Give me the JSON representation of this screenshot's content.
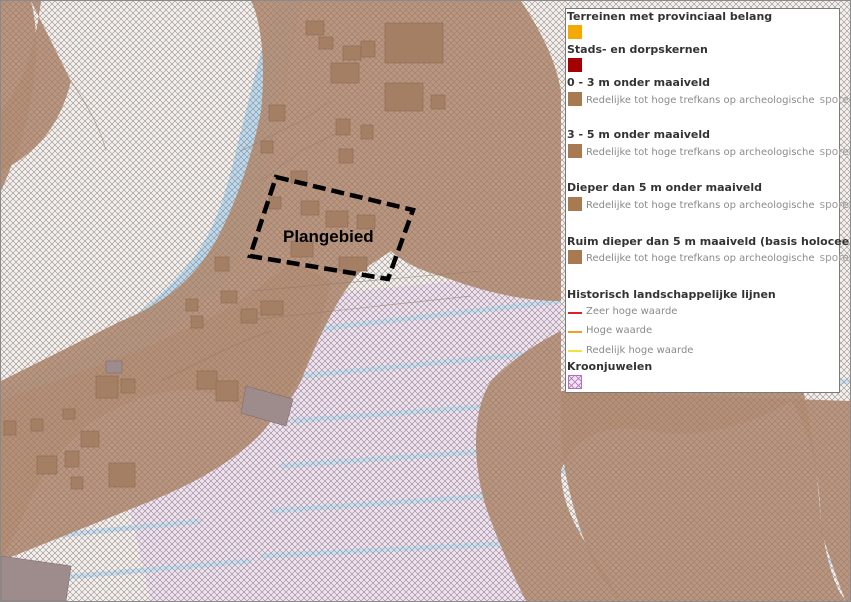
{
  "map": {
    "area_label": "Plangebied",
    "colors": {
      "background": "#f3f1ea",
      "zone_fill": "#b98e6e",
      "water": "#b9dcef",
      "buildings": "#a57f63",
      "kroonjuwelen_hatch": "#8f6f9a"
    }
  },
  "legend": {
    "provinciaal": {
      "title": "Terreinen met provinciaal belang",
      "color": "#f5a800"
    },
    "stads": {
      "title": "Stads- en dorpskernen",
      "color": "#a50000"
    },
    "zone1": {
      "title": "0 - 3 m onder maaiveld",
      "desc": "Redelijke tot hoge trefkans op archeologische",
      "suffix": "sporen",
      "color": "#a87a52"
    },
    "zone2": {
      "title": "3 - 5 m onder maaiveld",
      "desc": "Redelijke tot hoge trefkans op archeologische",
      "suffix": "sporen",
      "color": "#a87a52"
    },
    "zone3": {
      "title": "Dieper dan 5 m onder maaiveld",
      "desc": "Redelijke tot hoge trefkans op archeologische",
      "suffix": "sporen",
      "color": "#a87a52"
    },
    "zone4": {
      "title": "Ruim dieper dan 5 m maaiveld (basis holocee",
      "desc": "Redelijke tot hoge trefkans op archeologische",
      "suffix": "sporen",
      "color": "#a87a52"
    },
    "lijnen": {
      "title": "Historisch landschappelijke lijnen",
      "items": [
        {
          "label": "Zeer hoge waarde",
          "color": "#e02020"
        },
        {
          "label": "Hoge waarde",
          "color": "#f0a020"
        },
        {
          "label": "Redelijk hoge waarde",
          "color": "#f0e040"
        }
      ]
    },
    "kroonjuwelen": {
      "title": "Kroonjuwelen",
      "color": "#b070c0"
    }
  }
}
